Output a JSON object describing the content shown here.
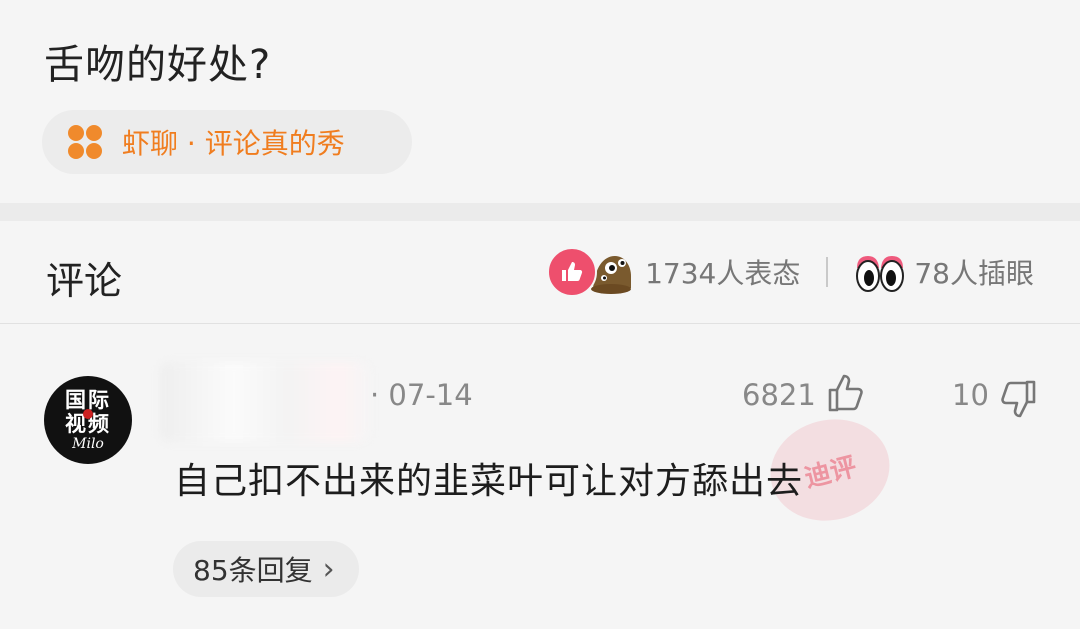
{
  "question": {
    "title": "舌吻的好处?"
  },
  "topic": {
    "label": "虾聊 · 评论真的秀"
  },
  "comments_header": {
    "title": "评论",
    "reactions_count": "1734人表态",
    "watch_count": "78人插眼"
  },
  "comment": {
    "avatar": {
      "line1": "国际",
      "line2": "视频",
      "line3": "Milo"
    },
    "date": "· 07-14",
    "likes": "6821",
    "dislikes": "10",
    "text": "自己扣不出来的韭菜叶可让对方舔出去",
    "replies_label": "85条回复"
  },
  "watermark": {
    "text": "迪评"
  },
  "colors": {
    "accent_orange": "#f07d1f",
    "like_pink": "#ee4f6d"
  }
}
